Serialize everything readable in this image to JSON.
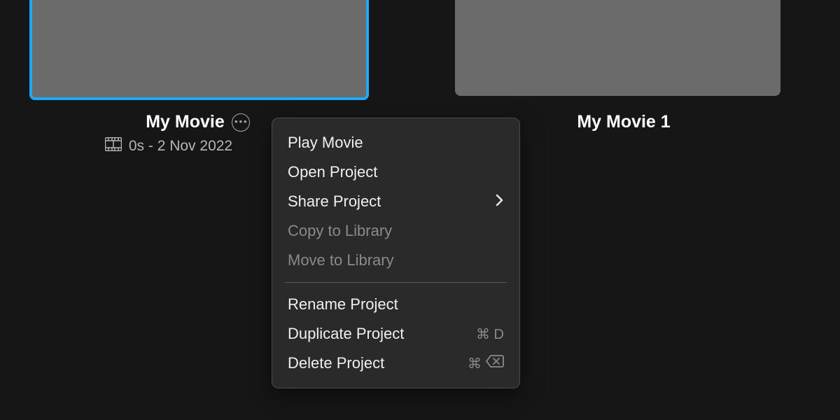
{
  "projects": {
    "p1": {
      "title": "My Movie",
      "meta": "0s - 2 Nov 2022"
    },
    "p2": {
      "title": "My Movie 1"
    }
  },
  "menu": {
    "play": "Play Movie",
    "open": "Open Project",
    "share": "Share Project",
    "copy": "Copy to Library",
    "move": "Move to Library",
    "rename": "Rename Project",
    "duplicate": "Duplicate Project",
    "delete": "Delete Project",
    "sc_duplicate": "⌘ D",
    "sc_delete_cmd": "⌘"
  }
}
